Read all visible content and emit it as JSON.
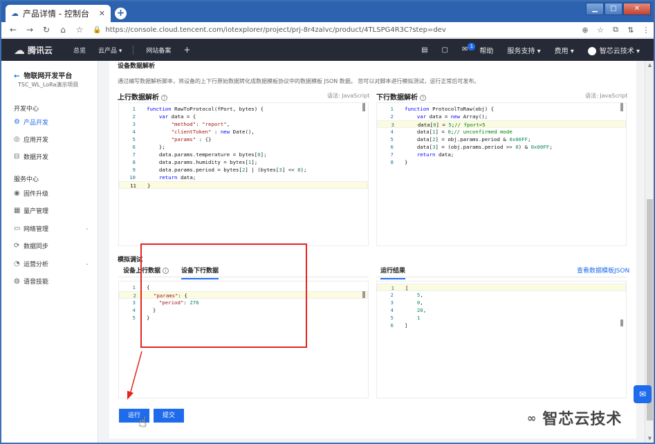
{
  "browser": {
    "tab_title": "产品详情 - 控制台",
    "url": "https://console.cloud.tencent.com/iotexplorer/project/prj-8r4zalvc/product/4TLSPG4R3C?step=dev"
  },
  "topnav": {
    "brand": "腾讯云",
    "items": [
      "总览",
      "云产品 ▾",
      "网站备案",
      "+"
    ],
    "mail_badge": "1",
    "help": "帮助",
    "support": "服务支持 ▾",
    "billing": "费用 ▾",
    "account": "智芯云技术 ▾"
  },
  "sidebar": {
    "title": "物联网开发平台",
    "subtitle": "TSC_WL_LoRa演示项目",
    "group1": "开发中心",
    "dev_items": [
      "产品开发",
      "应用开发",
      "数据开发"
    ],
    "group2": "服务中心",
    "svc_items": [
      "固件升级",
      "量产管理",
      "网络管理",
      "数据同步",
      "运营分析",
      "语音技能"
    ]
  },
  "main": {
    "section_title": "设备数据解析",
    "description": "通过编写数据解析脚本，将设备的上下行原始数据转化成数据模板协议中的数据模板 JSON 数据。 您可以对脚本进行模拟测试，运行正常后可发布。",
    "uplink_label": "上行数据解析",
    "downlink_label": "下行数据解析",
    "lang_label": "语法: JavaScript",
    "sim_title": "模拟调试",
    "sim_tabs": [
      "设备上行数据",
      "设备下行数据"
    ],
    "result_tab": "运行结果",
    "view_json_link": "查看数据模板JSON",
    "run_button": "运行",
    "submit_button": "提交"
  },
  "watermark": "智芯云技术"
}
